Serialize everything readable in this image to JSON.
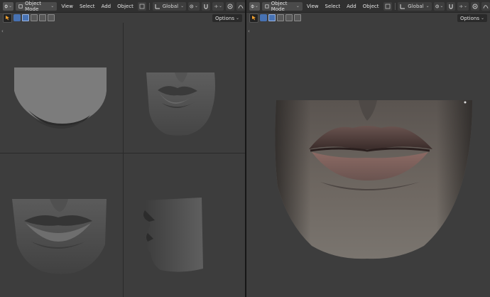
{
  "left": {
    "mode": "Object Mode",
    "menus": [
      "View",
      "Select",
      "Add",
      "Object"
    ],
    "transform": "Global",
    "options": "Options"
  },
  "right": {
    "mode": "Object Mode",
    "menus": [
      "View",
      "Select",
      "Add",
      "Object"
    ],
    "transform": "Global",
    "options": "Options"
  },
  "icons": {
    "editor": "editor-type-icon",
    "pivot": "transform-pivot-icon",
    "snap": "snap-magnet-icon",
    "proportional": "proportional-edit-icon",
    "falloff": "falloff-curve-icon",
    "select": "select-box-icon"
  },
  "colors": {
    "viewport": "#3d3d3d",
    "header": "#303030",
    "accent": "#4772b3"
  }
}
